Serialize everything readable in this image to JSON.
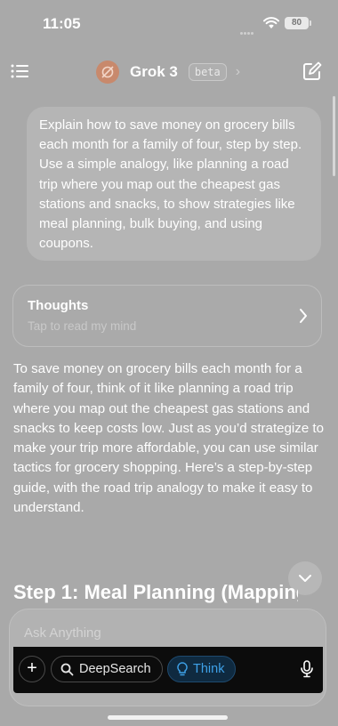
{
  "status_bar": {
    "time": "11:05",
    "battery": "80"
  },
  "header": {
    "title": "Grok 3",
    "badge": "beta"
  },
  "user_message": "Explain how to save money on grocery bills each month for a family of four, step by step. Use a simple analogy, like planning a road trip where you map out the cheapest gas stations and snacks, to show strategies like meal planning, bulk buying, and using coupons.",
  "thoughts": {
    "title": "Thoughts",
    "subtitle": "Tap to read my mind"
  },
  "response": {
    "paragraph": "To save money on grocery bills each month for a family of four, think of it like planning a road trip where you map out the cheapest gas stations and snacks to keep costs low. Just as you’d strategize to make your trip more affordable, you can use similar tactics for grocery shopping. Here’s a step-by-step guide, with the road trip analogy to make it easy to understand.",
    "heading": "Step 1: Meal Planning (Mapping"
  },
  "composer": {
    "placeholder": "Ask Anything",
    "plus_label": "+",
    "deepsearch_label": "DeepSearch",
    "think_label": "Think"
  },
  "icons": {
    "menu": "menu-icon",
    "logo": "grok-logo-icon",
    "compose": "compose-icon",
    "chevron_right": "chevron-right-icon",
    "chevron_down": "chevron-down-icon",
    "search": "search-icon",
    "lightbulb": "lightbulb-icon",
    "mic": "microphone-icon",
    "wifi": "wifi-icon"
  },
  "colors": {
    "background": "#a9a9a9",
    "think_accent": "#3ea1e8",
    "logo_accent": "#c8896c"
  }
}
